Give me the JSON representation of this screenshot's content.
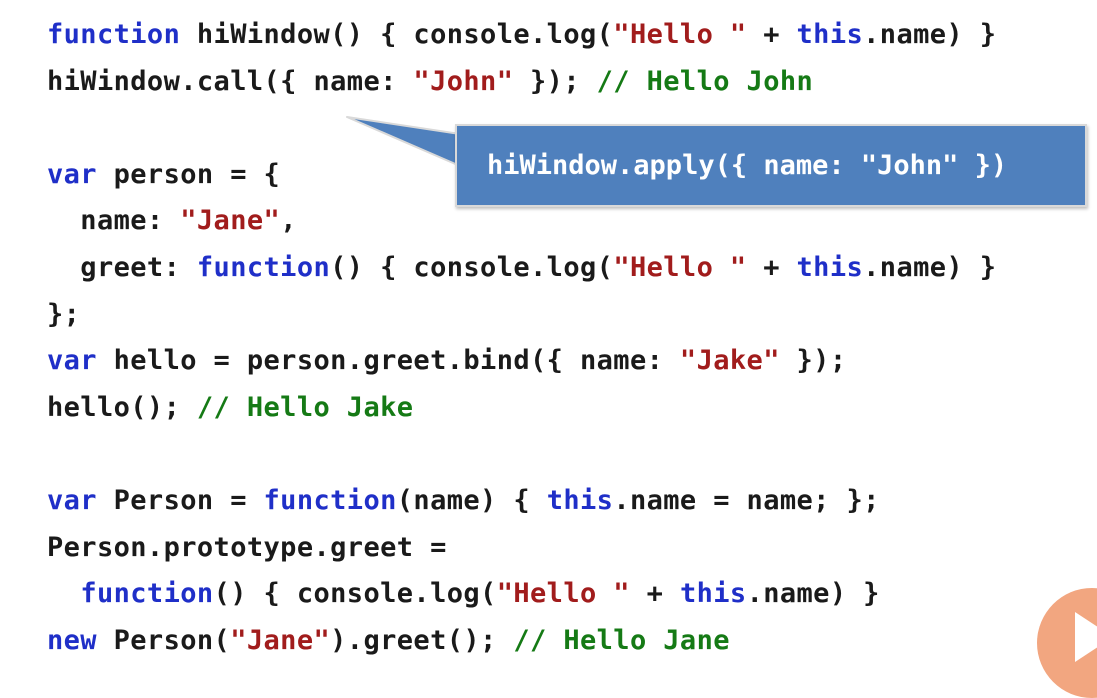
{
  "code": {
    "l1": {
      "kw1": "function",
      "t1": " hiWindow() { console.log(",
      "s1": "\"Hello \"",
      "t2": " + ",
      "kw2": "this",
      "t3": ".name) }"
    },
    "l2": {
      "t1": "hiWindow.call({ name: ",
      "s1": "\"John\"",
      "t2": " }); ",
      "c1": "// Hello John"
    },
    "l3": {
      "kw1": "var",
      "t1": " person = {"
    },
    "l4": {
      "t1": "  name: ",
      "s1": "\"Jane\"",
      "t2": ","
    },
    "l5": {
      "t1": "  greet: ",
      "kw1": "function",
      "t2": "() { console.log(",
      "s1": "\"Hello \"",
      "t3": " + ",
      "kw2": "this",
      "t4": ".name) }"
    },
    "l6": {
      "t1": "};"
    },
    "l7": {
      "kw1": "var",
      "t1": " hello = person.greet.bind({ name: ",
      "s1": "\"Jake\"",
      "t2": " });"
    },
    "l8": {
      "t1": "hello(); ",
      "c1": "// Hello Jake"
    },
    "l9": {
      "kw1": "var",
      "t1": " Person = ",
      "kw2": "function",
      "t2": "(name) { ",
      "kw3": "this",
      "t3": ".name = name; };"
    },
    "l10": {
      "t1": "Person.prototype.greet ="
    },
    "l11": {
      "t1": "  ",
      "kw1": "function",
      "t2": "() { console.log(",
      "s1": "\"Hello \"",
      "t3": " + ",
      "kw2": "this",
      "t4": ".name) }"
    },
    "l12": {
      "kw1": "new",
      "t1": " Person(",
      "s1": "\"Jane\"",
      "t2": ").greet(); ",
      "c1": "// Hello Jane"
    }
  },
  "callout": {
    "text": "hiWindow.apply({ name: \"John\" })"
  },
  "colors": {
    "keyword": "#1f2fc8",
    "string": "#a11c1c",
    "comment": "#157a15",
    "text": "#1a1a1a",
    "callout_bg": "#4f80bd",
    "play_button": "#f2a680"
  },
  "icons": {
    "play": "play-icon"
  }
}
